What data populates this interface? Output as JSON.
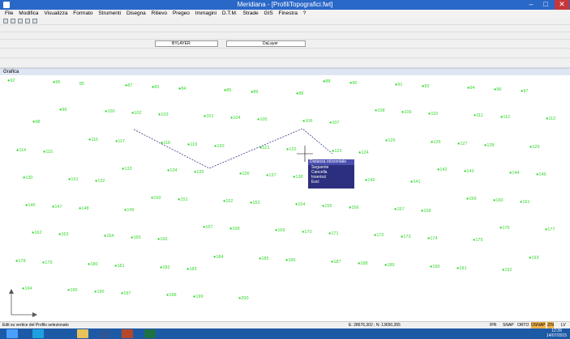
{
  "window": {
    "title": "Meridiana - [ProfiliTopografici.fwt]",
    "minimize": "–",
    "maximize": "□",
    "close": "✕"
  },
  "menu": [
    "File",
    "Modifica",
    "Visualizza",
    "Formato",
    "Strumenti",
    "Disegna",
    "Rilievo",
    "Pregeo",
    "Immagini",
    "D.T.M.",
    "Strade",
    "GIS",
    "Finestra",
    "?"
  ],
  "layer_bar": {
    "color_value": "BYLAYER",
    "linetype_value": "DaLayer"
  },
  "drawing_title": "Grafica",
  "context_menu": {
    "header": "Distanza orizzontale",
    "items": [
      "Seguente",
      "Cancella",
      "Inserisci",
      "Esci"
    ]
  },
  "status": {
    "left": "Edit su vertice del Profilo selezionato",
    "coords": "E: 28676,302 ; N: 13650,355",
    "modes": [
      "IPR",
      "SNAP",
      "ORTO",
      "OSNAP",
      "ZIN",
      "LV"
    ]
  },
  "clock": {
    "time": "12:39",
    "date": "14/07/2015"
  },
  "colors": {
    "points": "#34d82c",
    "title_bar": "#2a68c7",
    "taskbar": "#1c5aa6",
    "context_menu": "#2c2f7e"
  },
  "points": [
    "●92",
    "●95",
    "85",
    "●87",
    "●83",
    "●84",
    "●85",
    "●89",
    "●86",
    "●88",
    "●90",
    "●91",
    "●93",
    "●94",
    "●96",
    "●97",
    "●98",
    "●99",
    "●100",
    "●102",
    "●103",
    "●101",
    "●104",
    "●105",
    "●106",
    "●107",
    "●108",
    "●109",
    "●110",
    "●111",
    "●112",
    "●113",
    "●114",
    "●115",
    "●116",
    "●117",
    "●118",
    "●119",
    "●120",
    "●121",
    "●122",
    "●123",
    "●124",
    "●125",
    "●126",
    "●127",
    "●128",
    "●129",
    "●130",
    "●131",
    "●132",
    "●133",
    "●134",
    "●135",
    "●136",
    "●137",
    "●138",
    "●139",
    "●140",
    "●141",
    "●142",
    "●143",
    "●144",
    "●145",
    "●146",
    "●147",
    "●148",
    "●149",
    "●150",
    "●151",
    "●152",
    "●153",
    "●154",
    "●155",
    "●156",
    "●157",
    "●158",
    "●159",
    "●160",
    "●161",
    "●162",
    "●163",
    "●164",
    "●165",
    "●166",
    "●167",
    "●168",
    "●169",
    "●170",
    "●171",
    "●172",
    "●173",
    "●174",
    "●175",
    "●176",
    "●177",
    "●178",
    "●179",
    "●180",
    "●181",
    "●182",
    "●183",
    "●184",
    "●185",
    "●186",
    "●187",
    "●188",
    "●189",
    "●190",
    "●191",
    "●192",
    "●193",
    "●194",
    "●195",
    "●196",
    "●197",
    "●198",
    "●199",
    "●200"
  ]
}
